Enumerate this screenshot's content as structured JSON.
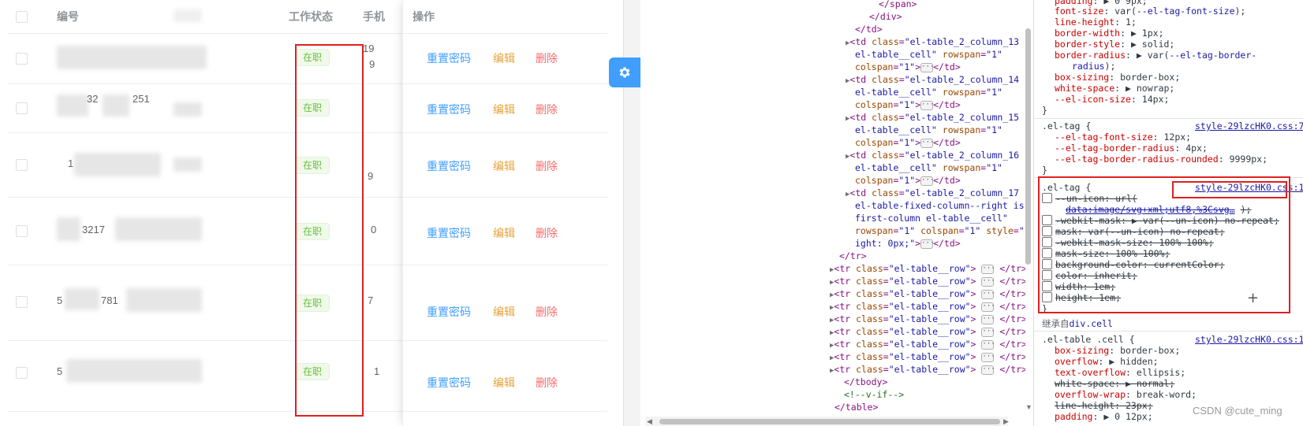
{
  "table": {
    "headers": {
      "id": "编号",
      "status": "工作状态",
      "phone": "手机",
      "ops": "操作"
    },
    "status_text": "在职",
    "ops": {
      "reset": "重置密码",
      "edit": "编辑",
      "delete": "删除"
    },
    "partials": [
      "19",
      "9",
      "32",
      "251",
      "1",
      "9",
      "3217",
      "0",
      "5",
      "781",
      "7",
      "5",
      "1"
    ]
  },
  "elements": {
    "lines": [
      {
        "indent": 0,
        "html": "&lt;/span&gt;"
      },
      {
        "indent": 0,
        "html": "&lt;/div&gt;"
      },
      {
        "indent": 0,
        "html": "&lt;/td&gt;"
      }
    ]
  },
  "styles": {
    "rule_tag_vars_selector": ".el-tag {",
    "rule_tag_vars_link": "style-29lzcHK0.css:7",
    "rule_tag_selector": ".el-tag {",
    "rule_tag_link": "style-29lzcHK0.css:1",
    "inherit_label": "继承自",
    "inherit_target": "div.cell",
    "rule_cell_selector": ".el-table .cell {",
    "rule_cell_link": "style-29lzcHK0.css:1"
  },
  "colors": {
    "accent": "#409eff",
    "success": "#67c23a",
    "warning": "#e6a23c",
    "danger": "#f56c6c",
    "highlight_box": "#e02020"
  },
  "watermark": "CSDN @cute_ming"
}
